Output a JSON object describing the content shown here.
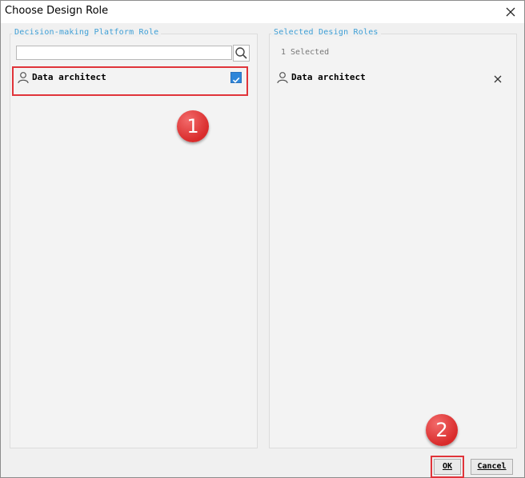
{
  "window": {
    "title": "Choose Design Role"
  },
  "left_panel": {
    "title": "Decision-making Platform Role",
    "search": {
      "value": "",
      "placeholder": ""
    },
    "roles": [
      {
        "label": "Data architect",
        "checked": true
      }
    ]
  },
  "right_panel": {
    "title": "Selected Design Roles",
    "count_text": "1 Selected",
    "selected": [
      {
        "label": "Data architect"
      }
    ]
  },
  "annotations": [
    "1",
    "2"
  ],
  "footer": {
    "ok_label": "OK",
    "cancel_label": "Cancel"
  },
  "colors": {
    "accent": "#3e9fd6",
    "checkbox": "#2f86d9",
    "highlight": "#e0343a",
    "badge": "#d92b2b"
  },
  "icons": {
    "user": "user-icon",
    "search": "search-icon",
    "close": "close-icon",
    "remove": "remove-icon",
    "check": "check-icon"
  }
}
